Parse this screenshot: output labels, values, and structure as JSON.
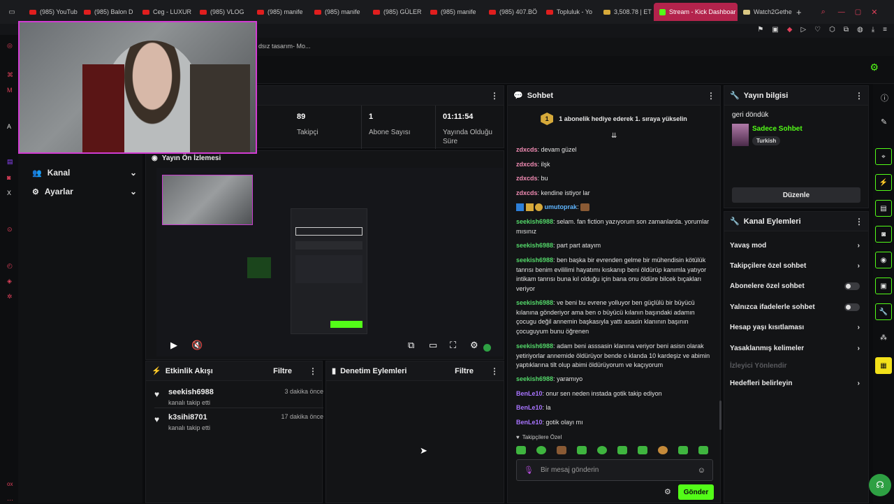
{
  "browser": {
    "tabs": [
      {
        "label": "(985) YouTub"
      },
      {
        "label": "(985) Balon D"
      },
      {
        "label": "Ceg - LUXUR"
      },
      {
        "label": "(985) VLOG"
      },
      {
        "label": "(985) manife"
      },
      {
        "label": "(985) manife"
      },
      {
        "label": "(985) GÜLER"
      },
      {
        "label": "(985) manife"
      },
      {
        "label": "(985) 407.BÖ"
      },
      {
        "label": "Topluluk - Yo"
      },
      {
        "label": "3,508.78 | ET"
      },
      {
        "label": "Stream - Kick Dashboar"
      },
      {
        "label": "Watch2Gethe"
      }
    ],
    "bookmark_text": "dsız tasarım- Mo..."
  },
  "nav": {
    "items": [
      {
        "label": "Kanal"
      },
      {
        "label": "Ayarlar"
      }
    ]
  },
  "stats": {
    "followers": {
      "value": "89",
      "label": "Takipçi"
    },
    "subs": {
      "value": "1",
      "label": "Abone Sayısı"
    },
    "uptime": {
      "value": "01:11:54",
      "label": "Yayında Olduğu Süre"
    }
  },
  "preview": {
    "title": "Yayın Ön İzlemesi"
  },
  "activity": {
    "title": "Etkinlik Akışı",
    "filter": "Filtre",
    "events": [
      {
        "name": "seekish6988",
        "sub": "kanalı takip etti",
        "time": "3 dakika önce"
      },
      {
        "name": "k3sihi8701",
        "sub": "kanalı takip etti",
        "time": "17 dakika önce"
      }
    ]
  },
  "moderation": {
    "title": "Denetim Eylemleri",
    "filter": "Filtre"
  },
  "chat": {
    "title": "Sohbet",
    "banner": "1 abonelik hediye ederek 1. sıraya yükselin",
    "banner_badge": "1",
    "messages": [
      {
        "user": "zdxcds",
        "text": "devam güzel",
        "color": "pink"
      },
      {
        "user": "zdxcds",
        "text": "ilşk",
        "color": "pink"
      },
      {
        "user": "zdxcds",
        "text": "bu",
        "color": "pink"
      },
      {
        "user": "zdxcds",
        "text": "kendine istiyor lar",
        "color": "pink"
      },
      {
        "user": "umutoprak",
        "text": "",
        "color": "cyan"
      },
      {
        "user": "seekish6988",
        "text": "selam. fan fiction yazıyorum son zamanlarda. yorumlar mısınız",
        "color": "green"
      },
      {
        "user": "seekish6988",
        "text": "part part atayım",
        "color": "green"
      },
      {
        "user": "seekish6988",
        "text": "ben başka bir evrenden gelme bir mühendisin kötülük tanrısı benim evililimi hayatımı kıskanıp beni öldürüp kanımla yatıyor intikam tanrısı buna kıl olduğu için bana onu öldüre bilcek bıçakları veriyor",
        "color": "green"
      },
      {
        "user": "seekish6988",
        "text": "ve beni bu evrene yolluyor ben güçlülü bir büyücü kılanına gönderiyor ama ben o büyücü kılanın başındaki adamın çocugu değil annemin başkasıyla yattı asasin klanının başının çocuguyum bunu öğrenen",
        "color": "green"
      },
      {
        "user": "seekish6988",
        "text": "adam beni asssasin klanına veriyor beni asisn olarak yetiriyorlar annemide öldürüyor bende o klanda 10 kardeşiz ve abimin yaptıklarına tilt olup abimi öldürüyorum ve kaçıyorum",
        "color": "green"
      },
      {
        "user": "seekish6988",
        "text": "yaramıyo",
        "color": "green"
      },
      {
        "user": "BenLe10",
        "text": "onur sen neden instada gotik takip ediyon",
        "color": "purple"
      },
      {
        "user": "BenLe10",
        "text": "la",
        "color": "purple"
      },
      {
        "user": "BenLe10",
        "text": "gotik olayı mı",
        "color": "purple"
      }
    ],
    "followers_only_label": "Takipçilere Özel",
    "input_placeholder": "Bir mesaj gönderin",
    "send_label": "Gönder"
  },
  "stream_info": {
    "title": "Yayın bilgisi",
    "stream_title": "geri döndük",
    "category": "Sadece Sohbet",
    "tag": "Turkish",
    "edit_label": "Düzenle"
  },
  "channel_actions": {
    "title": "Kanal Eylemleri",
    "items": [
      {
        "label": "Yavaş mod",
        "kind": "chevron"
      },
      {
        "label": "Takipçilere özel sohbet",
        "kind": "chevron"
      },
      {
        "label": "Abonelere özel sohbet",
        "kind": "toggle"
      },
      {
        "label": "Yalnızca ifadelerle sohbet",
        "kind": "toggle"
      },
      {
        "label": "Hesap yaşı kısıtlaması",
        "kind": "chevron"
      },
      {
        "label": "Yasaklanmış kelimeler",
        "kind": "chevron"
      },
      {
        "label": "İzleyici Yönlendir",
        "kind": "disabled"
      },
      {
        "label": "Hedefleri belirleyin",
        "kind": "chevron"
      }
    ]
  },
  "colors": {
    "accent": "#53fc18",
    "webcam_border": "#d23cd3",
    "kick_tab": "#b3234c"
  }
}
